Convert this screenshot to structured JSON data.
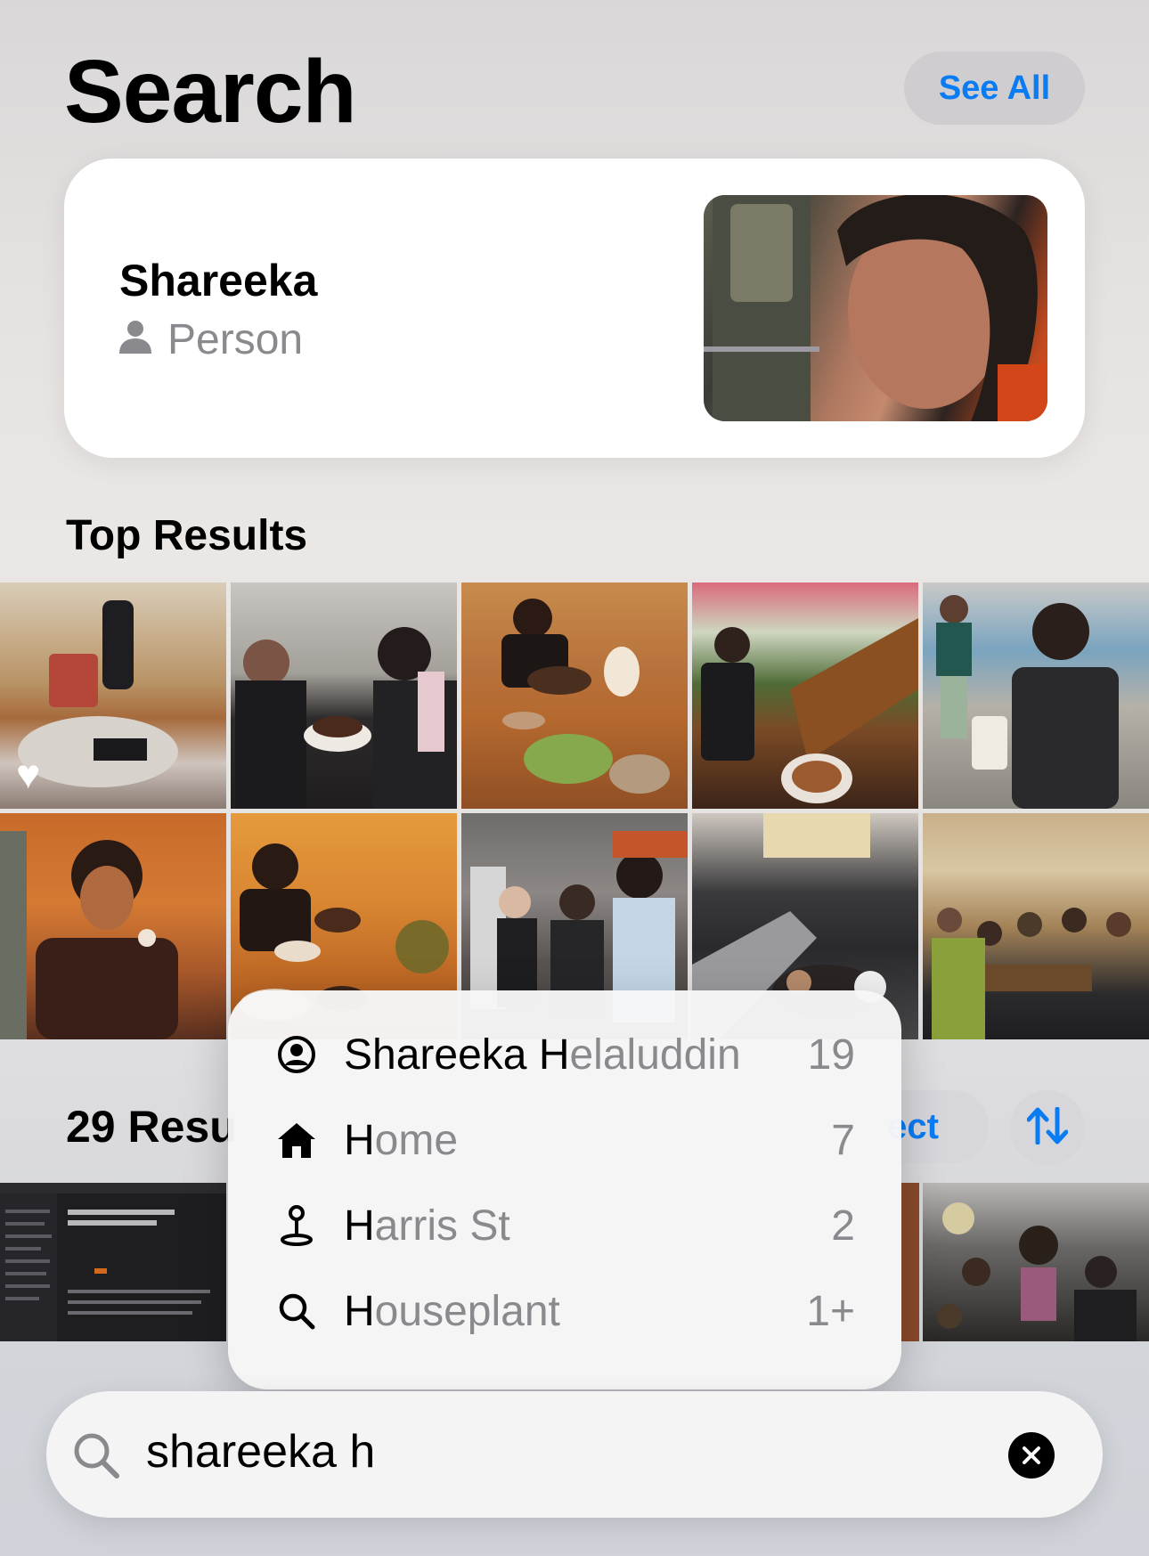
{
  "header": {
    "title": "Search",
    "see_all_label": "See All"
  },
  "person_card": {
    "name": "Shareeka",
    "type_label": "Person",
    "type_icon": "person-icon"
  },
  "top_results": {
    "heading": "Top Results",
    "photos": [
      {
        "desc": "living room with cat",
        "favorite": true
      },
      {
        "desc": "birthday cake"
      },
      {
        "desc": "dinner table"
      },
      {
        "desc": "restaurant with plants"
      },
      {
        "desc": "street scene"
      },
      {
        "desc": "portrait orange light"
      },
      {
        "desc": "dinner table orange light"
      },
      {
        "desc": "kitchen group"
      },
      {
        "desc": "escalator"
      },
      {
        "desc": "group dinner"
      }
    ]
  },
  "results": {
    "count_label": "29 Resu",
    "select_label": "ect",
    "sort_icon": "sort-arrows-icon"
  },
  "suggestions": {
    "typed_fragment": "H",
    "items": [
      {
        "icon": "person-circle-icon",
        "prefix": "Shareeka ",
        "typed": "H",
        "rest": "elaluddin",
        "count": "19"
      },
      {
        "icon": "house-icon",
        "prefix": "",
        "typed": "H",
        "rest": "ome",
        "count": "7"
      },
      {
        "icon": "map-pin-icon",
        "prefix": "",
        "typed": "H",
        "rest": "arris St",
        "count": "2"
      },
      {
        "icon": "magnifier-icon",
        "prefix": "",
        "typed": "H",
        "rest": "ouseplant",
        "count": "1+"
      }
    ]
  },
  "search_bar": {
    "query": "shareeka h",
    "search_icon": "search-icon",
    "clear_icon": "clear-icon"
  },
  "colors": {
    "accent": "#0a7cf3",
    "secondary_text": "#8a8a8e"
  }
}
